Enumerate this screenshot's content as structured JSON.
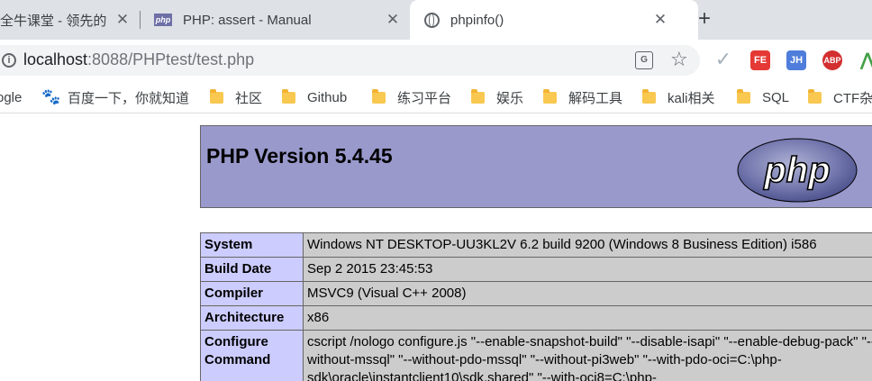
{
  "tabs": [
    {
      "title": "全牛课堂 - 领先的",
      "has_favicon": false
    },
    {
      "title": "PHP: assert - Manual",
      "favicon": "php"
    },
    {
      "title": "phpinfo()",
      "favicon": "globe-icon",
      "active": true
    }
  ],
  "new_tab_label": "+",
  "address_bar": {
    "host": "localhost",
    "rest": ":8088/PHPtest/test.php"
  },
  "extensions": {
    "fe_label": "FE",
    "jh_label": "JH",
    "abp_label": "ABP"
  },
  "bookmarks": [
    {
      "label": "ogle",
      "icon": "none"
    },
    {
      "label": "百度一下，你就知道",
      "icon": "baidu-paw-icon"
    },
    {
      "label": "社区",
      "icon": "folder-icon"
    },
    {
      "label": "Github",
      "icon": "folder-icon"
    },
    {
      "label": "练习平台",
      "icon": "folder-icon"
    },
    {
      "label": "娱乐",
      "icon": "folder-icon"
    },
    {
      "label": "解码工具",
      "icon": "folder-icon"
    },
    {
      "label": "kali相关",
      "icon": "folder-icon"
    },
    {
      "label": "SQL",
      "icon": "folder-icon"
    },
    {
      "label": "CTF杂",
      "icon": "folder-icon"
    }
  ],
  "phpinfo": {
    "version_title": "PHP Version 5.4.45",
    "logo_text": "php",
    "rows": [
      {
        "key": "System",
        "value": "Windows NT DESKTOP-UU3KL2V 6.2 build 9200 (Windows 8 Business Edition) i586"
      },
      {
        "key": "Build Date",
        "value": "Sep 2 2015 23:45:53"
      },
      {
        "key": "Compiler",
        "value": "MSVC9 (Visual C++ 2008)"
      },
      {
        "key": "Architecture",
        "value": "x86"
      },
      {
        "key": "Configure Command",
        "value": "cscript /nologo configure.js \"--enable-snapshot-build\" \"--disable-isapi\" \"--enable-debug-pack\" \"--without-mssql\" \"--without-pdo-mssql\" \"--without-pi3web\" \"--with-pdo-oci=C:\\php-sdk\\oracle\\instantclient10\\sdk,shared\" \"--with-oci8=C:\\php-"
      }
    ]
  },
  "colors": {
    "header_bg": "#9999cc",
    "key_bg": "#ccccff",
    "value_bg": "#cccccc",
    "tabstrip_bg": "#dee1e6"
  }
}
